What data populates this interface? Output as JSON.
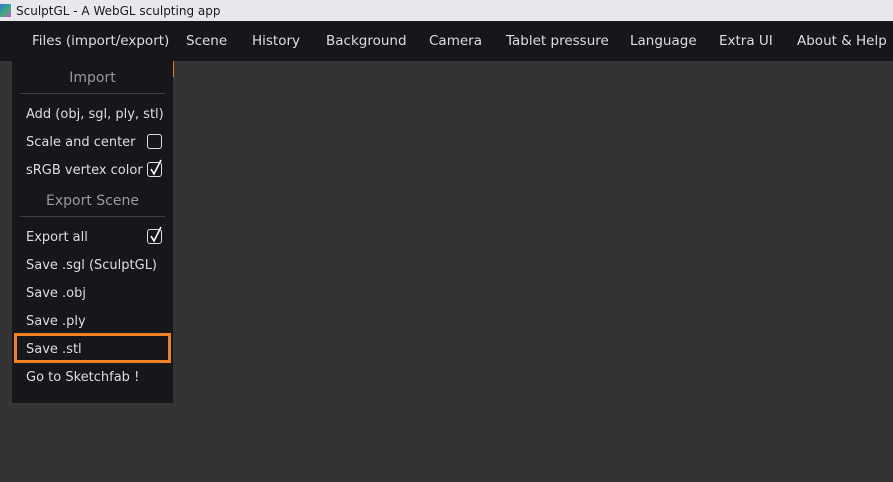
{
  "window": {
    "title": "SculptGL - A WebGL sculpting app",
    "icon": "sculptgl-app-icon"
  },
  "menubar": {
    "items": [
      {
        "label": "Files (import/export)"
      },
      {
        "label": "Scene"
      },
      {
        "label": "History"
      },
      {
        "label": "Background"
      },
      {
        "label": "Camera"
      },
      {
        "label": "Tablet pressure"
      },
      {
        "label": "Language"
      },
      {
        "label": "Extra UI"
      },
      {
        "label": "About & Help"
      }
    ]
  },
  "files_menu": {
    "import_title": "Import",
    "add_label": "Add (obj, sgl, ply, stl)",
    "scale_center_label": "Scale and center",
    "scale_center_checked": false,
    "srgb_label": "sRGB vertex color",
    "srgb_checked": true,
    "export_title": "Export Scene",
    "export_all_label": "Export all",
    "export_all_checked": true,
    "save_sgl_label": "Save .sgl (SculptGL)",
    "save_obj_label": "Save .obj",
    "save_ply_label": "Save .ply",
    "save_stl_label": "Save .stl",
    "sketchfab_label": "Go to Sketchfab !",
    "highlight_color": "#f28020"
  }
}
